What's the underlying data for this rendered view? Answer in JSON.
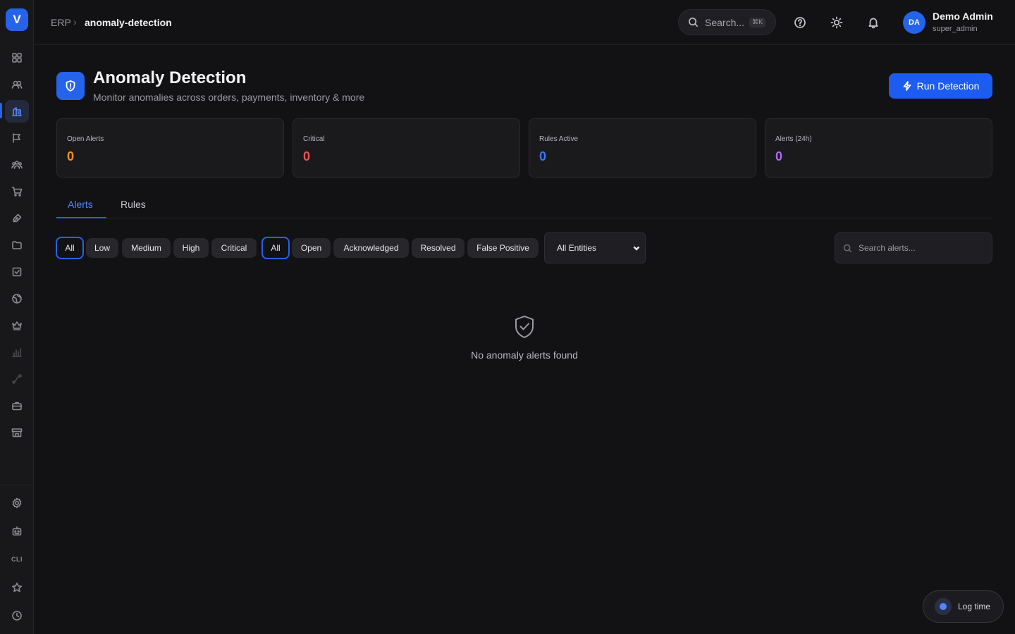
{
  "app": {
    "logo_letter": "V"
  },
  "breadcrumb": {
    "root": "ERP",
    "separator": "›",
    "current": "anomaly-detection"
  },
  "topbar": {
    "search_placeholder": "Search...",
    "search_shortcut": "⌘K",
    "user": {
      "initials": "DA",
      "name": "Demo Admin",
      "role": "super_admin"
    }
  },
  "sidebar": {
    "cli_label": "CLI",
    "icons": [
      "grid-icon",
      "users-icon",
      "analytics-icon",
      "campaign-icon",
      "team-icon",
      "cart-icon",
      "design-icon",
      "folder-icon",
      "tasks-icon",
      "globe-icon",
      "crown-icon",
      "chart-icon",
      "workflow-icon",
      "briefcase-icon",
      "store-icon",
      "settings-icon",
      "bot-icon",
      "cli-icon",
      "star-icon",
      "clock-icon"
    ],
    "active": "analytics-icon"
  },
  "header": {
    "title": "Anomaly Detection",
    "subtitle": "Monitor anomalies across orders, payments, inventory & more",
    "run_button": "Run Detection"
  },
  "stats": [
    {
      "label": "Open Alerts",
      "value": "0",
      "color": "#f5921e"
    },
    {
      "label": "Critical",
      "value": "0",
      "color": "#f05252"
    },
    {
      "label": "Rules Active",
      "value": "0",
      "color": "#3b76f6"
    },
    {
      "label": "Alerts (24h)",
      "value": "0",
      "color": "#b266f0"
    }
  ],
  "tabs": [
    {
      "label": "Alerts",
      "active": true
    },
    {
      "label": "Rules",
      "active": false
    }
  ],
  "filters": {
    "severity": [
      "All",
      "Low",
      "Medium",
      "High",
      "Critical"
    ],
    "status": [
      "All",
      "Open",
      "Acknowledged",
      "Resolved",
      "False Positive"
    ],
    "entity_select": "All Entities",
    "search_placeholder": "Search alerts..."
  },
  "empty_state": {
    "message": "No anomaly alerts found"
  },
  "log_time": {
    "label": "Log time"
  },
  "colors": {
    "accent": "#2563eb",
    "background": "#121214"
  }
}
